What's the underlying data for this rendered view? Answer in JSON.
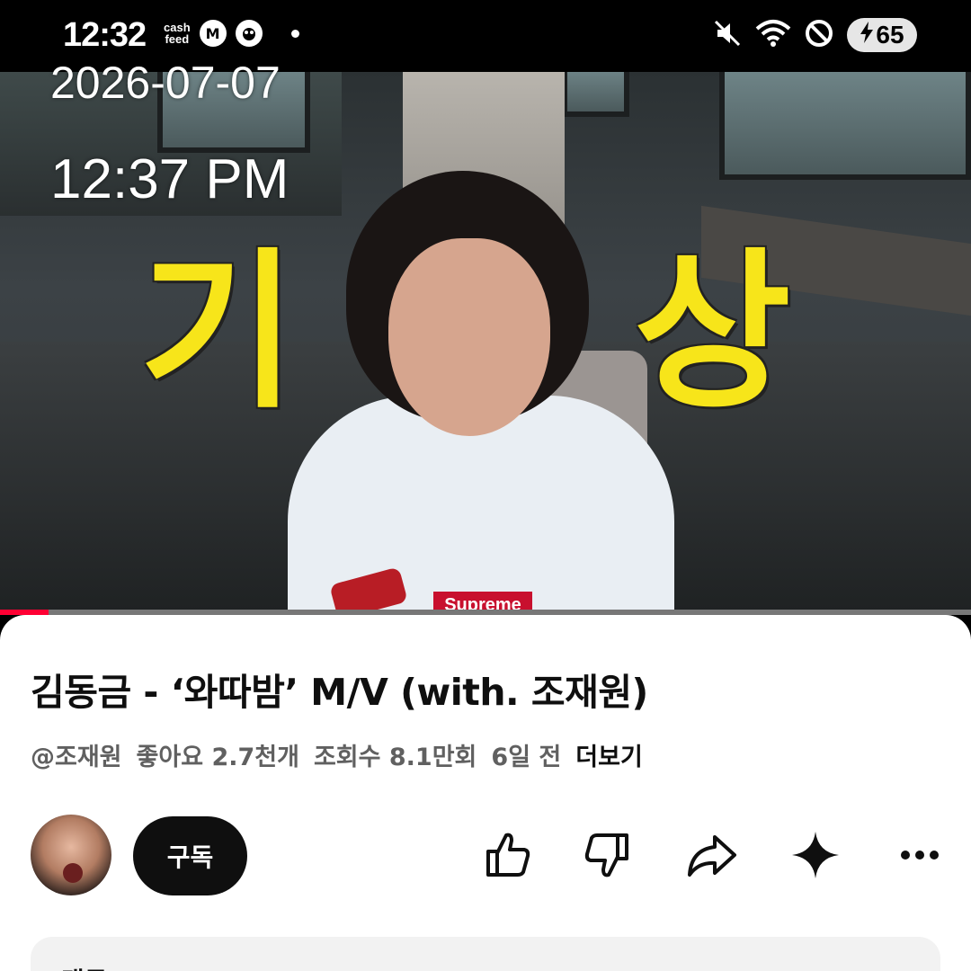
{
  "status_bar": {
    "time": "12:32",
    "cash_feed_line1": "cash",
    "cash_feed_line2": "feed",
    "app_icon_m": "M",
    "battery": "65",
    "icons": [
      "mute-icon",
      "wifi-icon",
      "do-not-disturb-icon",
      "battery-charging-icon"
    ]
  },
  "overlay": {
    "date": "2026-07-07",
    "time": "12:37 PM"
  },
  "video": {
    "caption_left": "기",
    "caption_right": "상",
    "shirt_logo": "Supreme",
    "progress": 0.05,
    "progress_color": "#ff0033"
  },
  "info": {
    "title": "김동금 - ‘와따밤’ M/V (with. 조재원)",
    "channel": "@조재원",
    "likes": "좋아요 2.7천개",
    "views": "조회수 8.1만회",
    "age": "6일 전",
    "more": "더보기",
    "subscribe": "구독",
    "actions": [
      "like-icon",
      "dislike-icon",
      "share-icon",
      "sparkle-icon",
      "more-icon"
    ],
    "comments_label": "댓글"
  }
}
